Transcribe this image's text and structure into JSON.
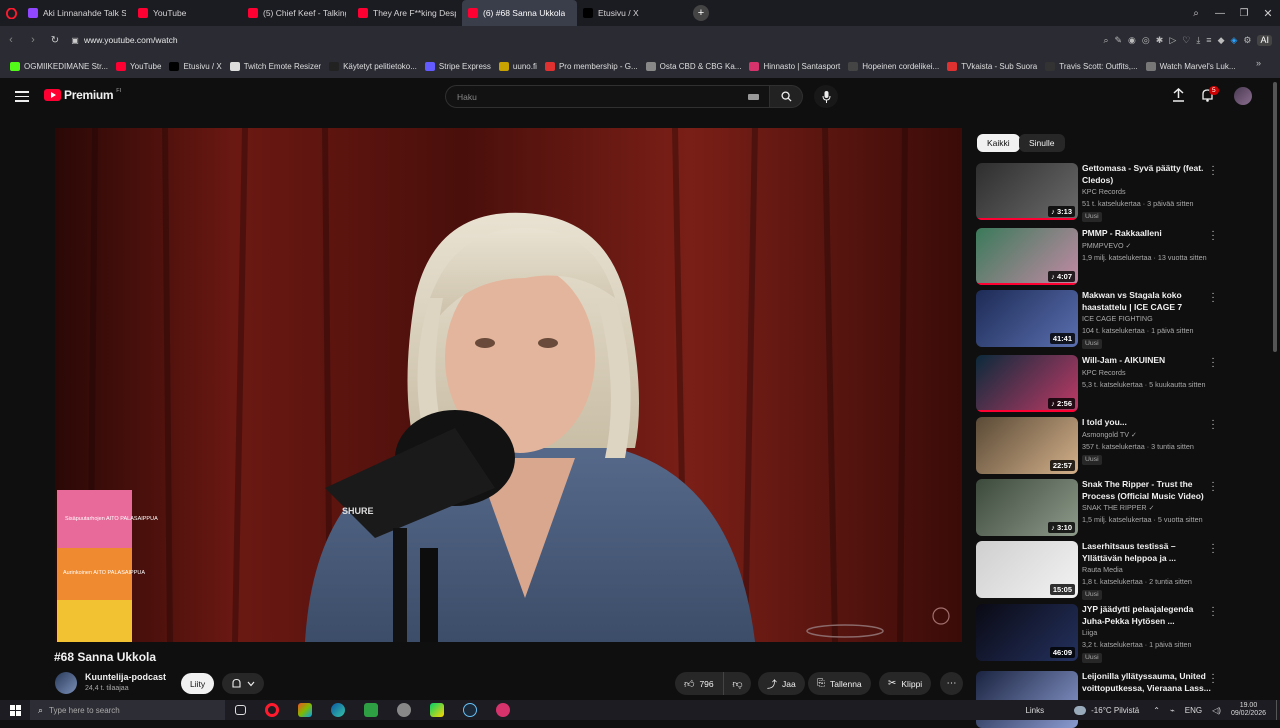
{
  "browser": {
    "tabs": [
      {
        "label": "Aki Linnanahde Talk Show",
        "color": "#9146ff"
      },
      {
        "label": "YouTube",
        "color": "#ff0033"
      },
      {
        "label": "(5) Chief Keef - Talking Int",
        "color": "#ff0033"
      },
      {
        "label": "They Are F**king Despera",
        "color": "#ff0033"
      },
      {
        "label": "(6) #68 Sanna Ukkola",
        "color": "#ff0033",
        "active": true
      },
      {
        "label": "Etusivu / X",
        "color": "#000000"
      }
    ],
    "url": "www.youtube.com/watch",
    "bookmarks": [
      {
        "label": "OGMIIKEDIMANE Str...",
        "color": "#53fc18"
      },
      {
        "label": "YouTube",
        "color": "#ff0033"
      },
      {
        "label": "Etusivu / X",
        "color": "#000000"
      },
      {
        "label": "Twitch Emote Resizer",
        "color": "#dddddd"
      },
      {
        "label": "Käytetyt pelitietoko...",
        "color": "#222222"
      },
      {
        "label": "Stripe Express",
        "color": "#635bff"
      },
      {
        "label": "uuno.fi",
        "color": "#c8a200"
      },
      {
        "label": "Pro membership - G...",
        "color": "#e03131"
      },
      {
        "label": "Osta CBD & CBG Ka...",
        "color": "#888888"
      },
      {
        "label": "Hinnasto | Santasport",
        "color": "#d6336c"
      },
      {
        "label": "Hopeinen cordelikei...",
        "color": "#444444"
      },
      {
        "label": "TVkaista - Sub Suora",
        "color": "#e03131"
      },
      {
        "label": "Travis Scott: Outfits,...",
        "color": "#333333"
      },
      {
        "label": "Watch Marvel's Luk...",
        "color": "#777777"
      }
    ]
  },
  "header": {
    "logo_label": "Premium",
    "logo_sup": "FI",
    "search_placeholder": "Haku",
    "notification_count": "5"
  },
  "video": {
    "title": "#68 Sanna Ukkola",
    "mic_brand": "SHURE",
    "product_text_1": "Sisäpuutarhojen AITO PALASAIPPUA",
    "product_text_2": "Aurinkoinen AITO PALASAIPPUA"
  },
  "channel": {
    "name": "Kuuntelija-podcast",
    "subs": "24,4 t. tilaajaa",
    "join_label": "Liity"
  },
  "actions": {
    "likes": "796",
    "share": "Jaa",
    "save": "Tallenna",
    "clip": "Klippi"
  },
  "sidebar": {
    "chips": [
      "Kaikki",
      "Sinulle"
    ],
    "recommendations": [
      {
        "title": "Gettomasa - Syvä päätty (feat. Cledos)",
        "channel": "KPC Records",
        "verified": false,
        "meta": "51 t. katselukertaa · 3 päivää sitten",
        "badge": "Uusi",
        "duration": "3:13",
        "music": true,
        "colors": [
          "#2e2e2e",
          "#6b6b6b"
        ]
      },
      {
        "title": "PMMP - Rakkaalleni",
        "channel": "PMMPVEVO",
        "verified": true,
        "meta": "1,9 milj. katselukertaa · 13 vuotta sitten",
        "badge": "",
        "duration": "4:07",
        "music": true,
        "colors": [
          "#3a7a5a",
          "#c48aa5"
        ]
      },
      {
        "title": "Makwan vs Stagala koko haastattelu | ICE CAGE 7",
        "channel": "ICE CAGE FIGHTING",
        "verified": false,
        "meta": "104 t. katselukertaa · 1 päivä sitten",
        "badge": "Uusi",
        "duration": "41:41",
        "music": false,
        "colors": [
          "#1d2b55",
          "#5a6fb0"
        ]
      },
      {
        "title": "Will-Jam - AIKUINEN",
        "channel": "KPC Records",
        "verified": false,
        "meta": "5,3 t. katselukertaa · 5 kuukautta sitten",
        "badge": "",
        "duration": "2:56",
        "music": true,
        "colors": [
          "#0b2a3b",
          "#c03a66"
        ]
      },
      {
        "title": "I told you...",
        "channel": "Asmongold TV",
        "verified": true,
        "meta": "357 t. katselukertaa · 3 tuntia sitten",
        "badge": "Uusi",
        "duration": "22:57",
        "music": false,
        "colors": [
          "#5a4a36",
          "#d3b08a"
        ]
      },
      {
        "title": "Snak The Ripper - Trust the Process (Official Music Video)",
        "channel": "SNAK THE RIPPER",
        "verified": true,
        "meta": "1,5 milj. katselukertaa · 5 vuotta sitten",
        "badge": "",
        "duration": "3:10",
        "music": true,
        "colors": [
          "#3c4a3c",
          "#8e9a8a"
        ]
      },
      {
        "title": "Laserhitsaus testissä – Yllättävän helppoa ja ...",
        "channel": "Rauta Media",
        "verified": false,
        "meta": "1,8 t. katselukertaa · 2 tuntia sitten",
        "badge": "Uusi",
        "duration": "15:05",
        "music": false,
        "colors": [
          "#cfcfcf",
          "#f3f3f3"
        ]
      },
      {
        "title": "JYP jäädytti pelaajalegenda Juha-Pekka Hytösen ...",
        "channel": "Liiga",
        "verified": false,
        "meta": "3,2 t. katselukertaa · 1 päivä sitten",
        "badge": "Uusi",
        "duration": "46:09",
        "music": false,
        "colors": [
          "#0a0a14",
          "#24315e"
        ]
      },
      {
        "title": "Leijonilla yllätyssauma, United voittoputkessa, Vieraana Lass...",
        "channel": "",
        "verified": false,
        "meta": "",
        "badge": "",
        "duration": "",
        "music": false,
        "colors": [
          "#1a2340",
          "#8a9bd0"
        ]
      }
    ]
  },
  "taskbar": {
    "search_placeholder": "Type here to search",
    "links": "Links",
    "weather": "-16°C Pilvistä",
    "lang": "ENG",
    "time": "19.00",
    "date": "09/02/2026"
  },
  "colors": {
    "accent": "#ff0033",
    "page_bg": "#0f0f0f",
    "curtain": "#5a1410"
  }
}
